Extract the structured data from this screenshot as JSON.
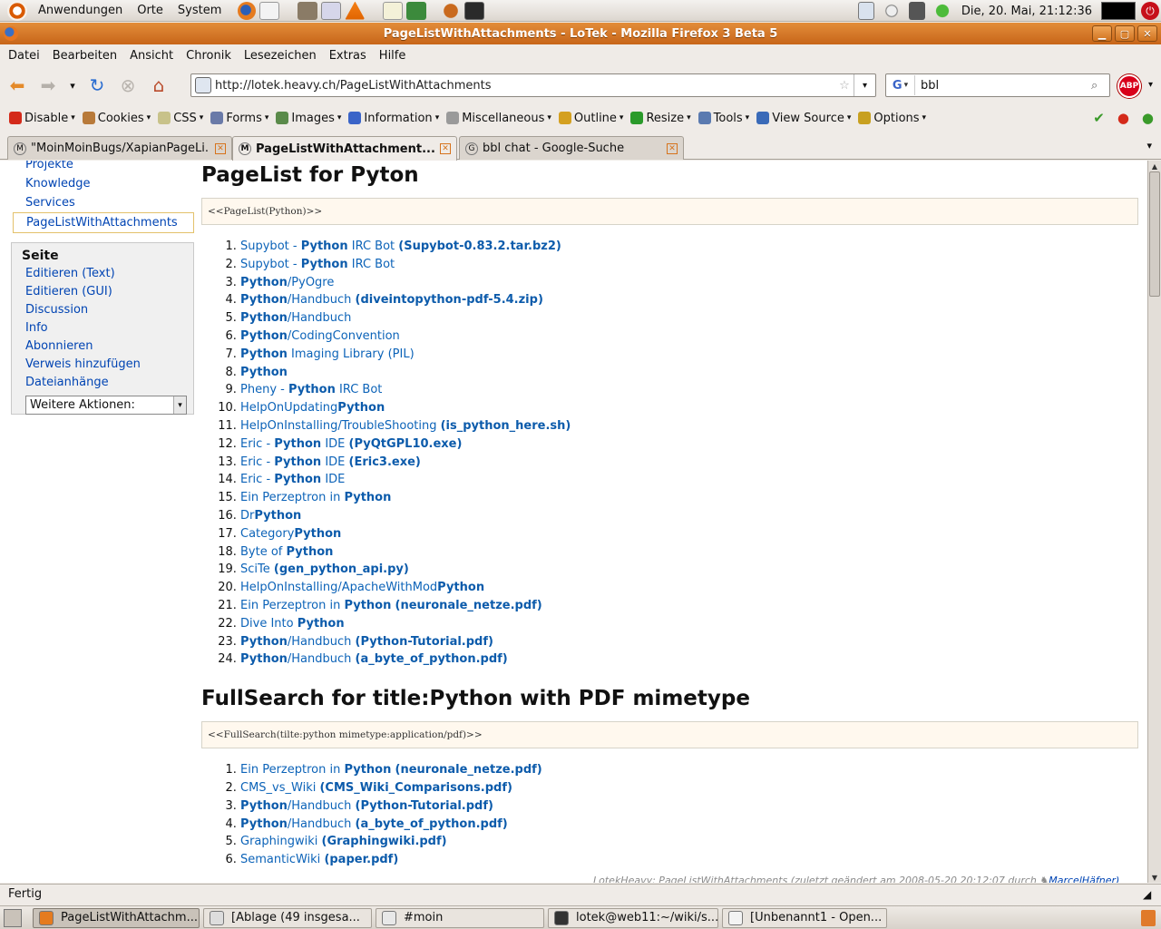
{
  "gnome_panel": {
    "menus": [
      "Anwendungen",
      "Orte",
      "System"
    ],
    "clock": "Die, 20. Mai, 21:12:36"
  },
  "window": {
    "title": "PageListWithAttachments - LoTek - Mozilla Firefox 3 Beta 5"
  },
  "menubar": [
    "Datei",
    "Bearbeiten",
    "Ansicht",
    "Chronik",
    "Lesezeichen",
    "Extras",
    "Hilfe"
  ],
  "navigation": {
    "url": "http://lotek.heavy.ch/PageListWithAttachments",
    "search_value": "bbl",
    "search_engine_icon": "G",
    "adblock_label": "ABP"
  },
  "devtoolbar": [
    "Disable",
    "Cookies",
    "CSS",
    "Forms",
    "Images",
    "Information",
    "Miscellaneous",
    "Outline",
    "Resize",
    "Tools",
    "View Source",
    "Options"
  ],
  "tabs": [
    {
      "label": "\"MoinMoinBugs/XapianPageLi...",
      "active": false
    },
    {
      "label": "PageListWithAttachment...",
      "active": true
    },
    {
      "label": "bbl chat - Google-Suche",
      "active": false
    }
  ],
  "sidebar": {
    "nav": [
      "Projekte",
      "Knowledge",
      "Services",
      "PageListWithAttachments"
    ],
    "box_title": "Seite",
    "actions": [
      "Editieren (Text)",
      "Editieren (GUI)",
      "Discussion",
      "Info",
      "Abonnieren",
      "Verweis hinzufügen",
      "Dateianhänge"
    ],
    "more_actions": "Weitere Aktionen:"
  },
  "main": {
    "heading1": "PageList for Pyton",
    "macro1": "<<PageList(Python)>>",
    "list1": [
      {
        "pre": "Supybot - ",
        "bold": "Python",
        "post": " IRC Bot ",
        "att": "(Supybot-0.83.2.tar.bz2)"
      },
      {
        "pre": "Supybot - ",
        "bold": "Python",
        "post": " IRC Bot",
        "att": ""
      },
      {
        "pre": "",
        "bold": "Python",
        "post": "/PyOgre",
        "att": ""
      },
      {
        "pre": "",
        "bold": "Python",
        "post": "/Handbuch ",
        "att": "(diveintopython-pdf-5.4.zip)"
      },
      {
        "pre": "",
        "bold": "Python",
        "post": "/Handbuch",
        "att": ""
      },
      {
        "pre": "",
        "bold": "Python",
        "post": "/CodingConvention",
        "att": ""
      },
      {
        "pre": "",
        "bold": "Python",
        "post": " Imaging Library (PIL)",
        "att": ""
      },
      {
        "pre": "",
        "bold": "Python",
        "post": "",
        "att": ""
      },
      {
        "pre": "Pheny - ",
        "bold": "Python",
        "post": " IRC Bot",
        "att": ""
      },
      {
        "pre": "HelpOnUpdating",
        "bold": "Python",
        "post": "",
        "att": ""
      },
      {
        "pre": "HelpOnInstalling/TroubleShooting ",
        "bold": "",
        "post": "",
        "att": "(is_python_here.sh)"
      },
      {
        "pre": "Eric - ",
        "bold": "Python",
        "post": " IDE ",
        "att": "(PyQtGPL10.exe)"
      },
      {
        "pre": "Eric - ",
        "bold": "Python",
        "post": " IDE ",
        "att": "(Eric3.exe)"
      },
      {
        "pre": "Eric - ",
        "bold": "Python",
        "post": " IDE",
        "att": ""
      },
      {
        "pre": "Ein Perzeptron in ",
        "bold": "Python",
        "post": "",
        "att": ""
      },
      {
        "pre": "Dr",
        "bold": "Python",
        "post": "",
        "att": ""
      },
      {
        "pre": "Category",
        "bold": "Python",
        "post": "",
        "att": ""
      },
      {
        "pre": "Byte of ",
        "bold": "Python",
        "post": "",
        "att": ""
      },
      {
        "pre": "SciTe ",
        "bold": "",
        "post": "",
        "att": "(gen_python_api.py)"
      },
      {
        "pre": "HelpOnInstalling/ApacheWithMod",
        "bold": "Python",
        "post": "",
        "att": ""
      },
      {
        "pre": "Ein Perzeptron in ",
        "bold": "Python",
        "post": " ",
        "att": "(neuronale_netze.pdf)"
      },
      {
        "pre": "Dive Into ",
        "bold": "Python",
        "post": "",
        "att": ""
      },
      {
        "pre": "",
        "bold": "Python",
        "post": "/Handbuch ",
        "att": "(Python-Tutorial.pdf)"
      },
      {
        "pre": "",
        "bold": "Python",
        "post": "/Handbuch ",
        "att": "(a_byte_of_python.pdf)"
      }
    ],
    "heading2": "FullSearch for title:Python with PDF mimetype",
    "macro2": "<<FullSearch(tilte:python mimetype:application/pdf)>>",
    "list2": [
      {
        "pre": "Ein Perzeptron in ",
        "bold": "Python",
        "post": " ",
        "att": "(neuronale_netze.pdf)"
      },
      {
        "pre": "CMS_vs_Wiki ",
        "bold": "",
        "post": "",
        "att": "(CMS_Wiki_Comparisons.pdf)"
      },
      {
        "pre": "",
        "bold": "Python",
        "post": "/Handbuch ",
        "att": "(Python-Tutorial.pdf)"
      },
      {
        "pre": "",
        "bold": "Python",
        "post": "/Handbuch ",
        "att": "(a_byte_of_python.pdf)"
      },
      {
        "pre": "Graphingwiki ",
        "bold": "",
        "post": "",
        "att": "(Graphingwiki.pdf)"
      },
      {
        "pre": "SemanticWiki ",
        "bold": "",
        "post": "",
        "att": "(paper.pdf)"
      }
    ],
    "footer_text": "LotekHeavy: PageListWithAttachments (zuletzt geändert am 2008-05-20 20:12:07 durch",
    "footer_user": "MarcelHäfner)"
  },
  "status": "Fertig",
  "taskbar": [
    {
      "label": "PageListWithAttachm...",
      "active": true
    },
    {
      "label": "[Ablage (49 insgesa...",
      "active": false
    },
    {
      "label": "#moin",
      "active": false
    },
    {
      "label": "lotek@web11:~/wiki/s...",
      "active": false
    },
    {
      "label": "[Unbenannt1 - Open...",
      "active": false
    }
  ],
  "colors": {
    "link": "#0c63b8",
    "titlebar": "#d6731c",
    "macro_bg": "#fff8ee"
  }
}
